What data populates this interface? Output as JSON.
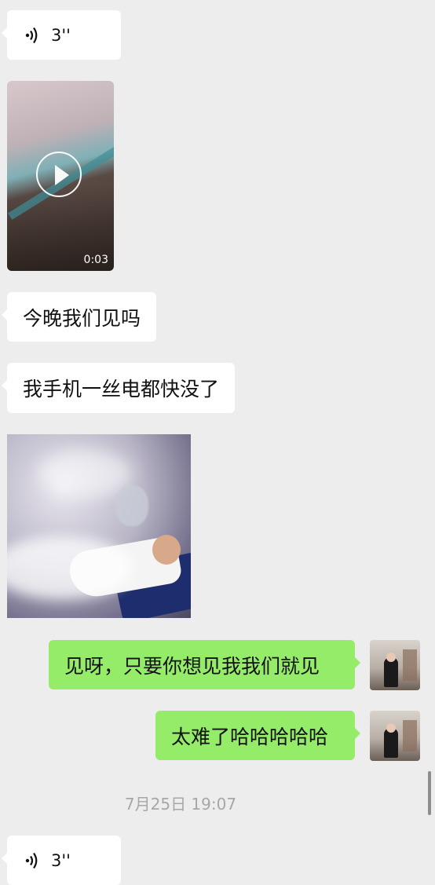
{
  "messages": {
    "voice1": {
      "duration": "3''"
    },
    "video": {
      "duration": "0:03"
    },
    "text1": "今晚我们见吗",
    "text2": "我手机一丝电都快没了",
    "sent1": "见呀，只要你想见我我们就见",
    "sent2": "太难了哈哈哈哈哈",
    "voice2": {
      "duration": "3''"
    }
  },
  "timestamp": "7月25日 19:07",
  "colors": {
    "background": "#ededed",
    "incoming_bubble": "#ffffff",
    "outgoing_bubble": "#95ec69",
    "timestamp": "#a7a7a7"
  }
}
